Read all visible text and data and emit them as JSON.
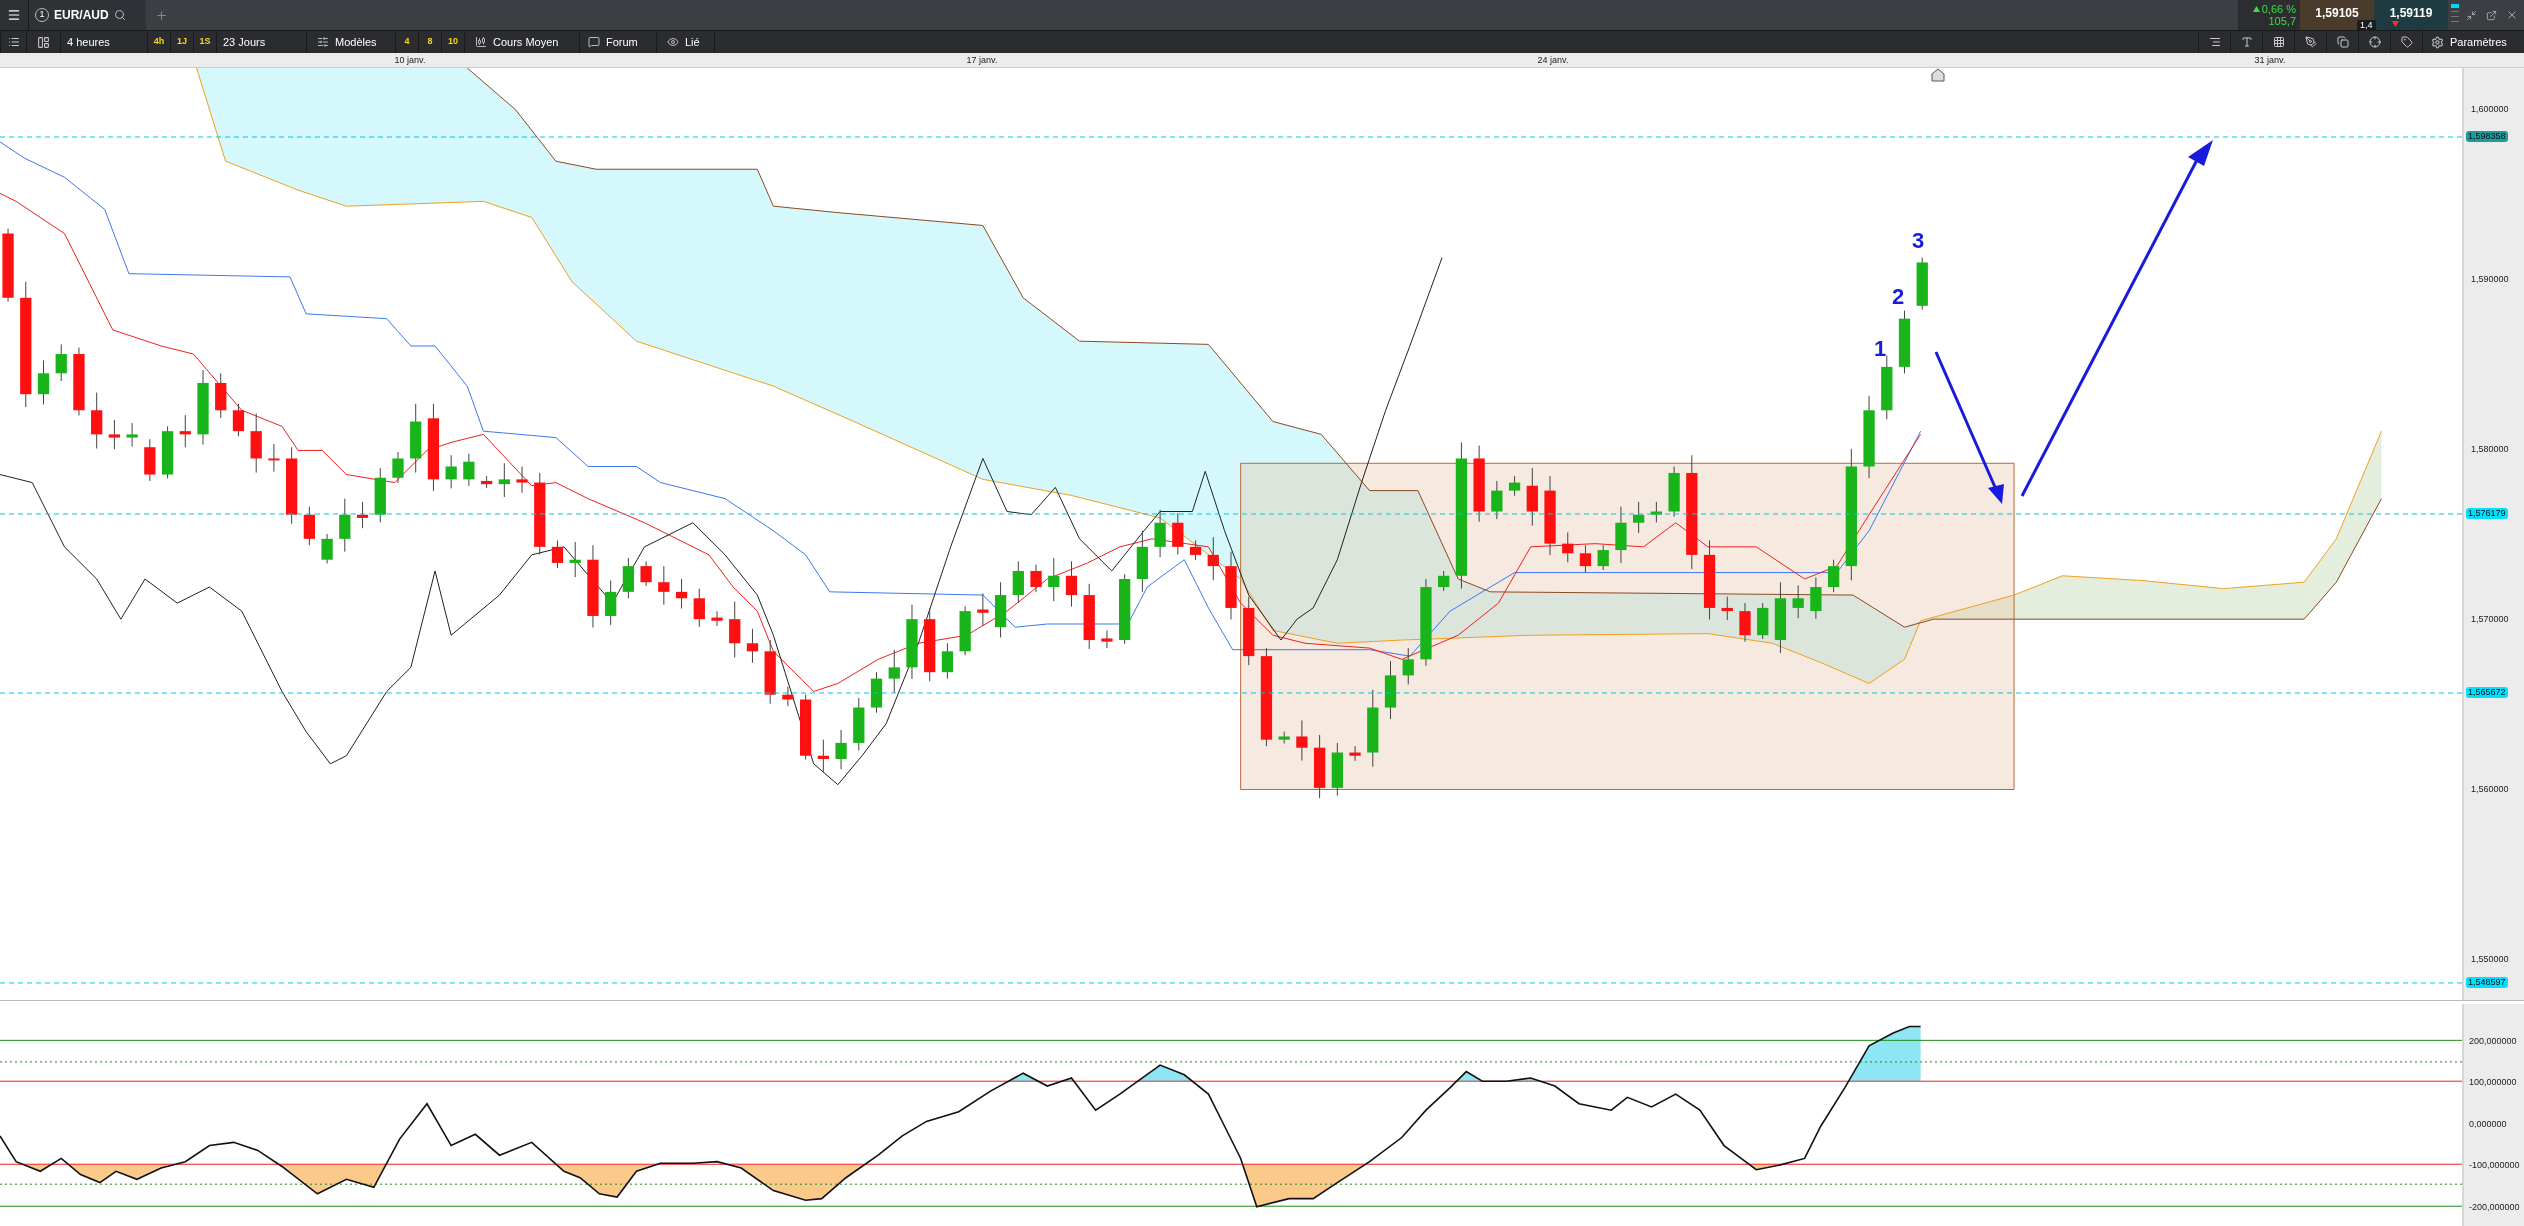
{
  "top_bar": {
    "symbol_number": "1",
    "symbol": "EUR/AUD",
    "change": "0,66 %",
    "change_points": "105,7",
    "bid": "1,59105",
    "ask": "1,59119",
    "spread": "1,4"
  },
  "toolbar": {
    "timeframe": "4 heures",
    "quick_timeframes": [
      "4h",
      "1J",
      "1S"
    ],
    "range": "23 Jours",
    "templates_label": "Modèles",
    "template_numbers": [
      "4",
      "8",
      "10"
    ],
    "chart_type": "Cours Moyen",
    "forum": "Forum",
    "linked": "Lié",
    "settings": "Paramètres"
  },
  "date_axis": [
    "10 janv.",
    "17 janv.",
    "24 janv.",
    "31 janv."
  ],
  "price_axis": {
    "ticks": [
      "1,600000",
      "1,590000",
      "1,580000",
      "1,570000",
      "1,560000",
      "1,550000"
    ],
    "price_lines": [
      {
        "label": "1,598358",
        "color": "#1e9c9c"
      },
      {
        "label": "1,576179",
        "color": "#00e1ff"
      },
      {
        "label": "1,565672",
        "color": "#00e1ff"
      },
      {
        "label": "1,548597",
        "color": "#00e1ff"
      }
    ]
  },
  "wave_labels": [
    "1",
    "2",
    "3"
  ],
  "indicator_axis": {
    "ticks": [
      "200,000000",
      "100,000000",
      "0,000000",
      "-100,000000",
      "-200,000000"
    ]
  }
}
